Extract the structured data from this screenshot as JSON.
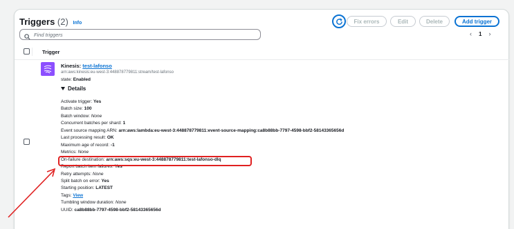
{
  "header": {
    "title": "Triggers",
    "count": "(2)",
    "info": "Info",
    "buttons": {
      "fix_errors": "Fix errors",
      "edit": "Edit",
      "delete": "Delete",
      "add_trigger": "Add trigger"
    }
  },
  "search": {
    "placeholder": "Find triggers"
  },
  "pagination": {
    "current_page": "1"
  },
  "table": {
    "column_trigger": "Trigger"
  },
  "trigger": {
    "service": "Kinesis:",
    "name": "test-lafonso",
    "arn": "arn:aws:kinesis:eu-west-3:448878779811:stream/test-lafonso",
    "state_label": "state:",
    "state_value": "Enabled",
    "details_label": "Details",
    "details": [
      {
        "label": "Activate trigger:",
        "value": "Yes",
        "style": "bold"
      },
      {
        "label": "Batch size:",
        "value": "100",
        "style": "bold"
      },
      {
        "label": "Batch window:",
        "value": "None",
        "style": "italic"
      },
      {
        "label": "Concurrent batches per shard:",
        "value": "1",
        "style": "bold"
      },
      {
        "label": "Event source mapping ARN:",
        "value": "arn:aws:lambda:eu-west-3:448878779811:event-source-mapping:ca8b88bb-7797-4598-bbf2-58143365656d",
        "style": "bold"
      },
      {
        "label": "Last processing result:",
        "value": "OK",
        "style": "bold"
      },
      {
        "label": "Maximum age of record:",
        "value": "-1",
        "style": "bold"
      },
      {
        "label": "Metrics:",
        "value": "None",
        "style": "italic"
      },
      {
        "label": "On-failure destination:",
        "value": "arn:aws:sqs:eu-west-3:448878779811:test-lafonso-dlq",
        "style": "bold"
      },
      {
        "label": "Report batch item failures:",
        "value": "Yes",
        "style": "bold"
      },
      {
        "label": "Retry attempts:",
        "value": "None",
        "style": "italic"
      },
      {
        "label": "Split batch on error:",
        "value": "Yes",
        "style": "bold"
      },
      {
        "label": "Starting position:",
        "value": "LATEST",
        "style": "bold"
      },
      {
        "label": "Tags:",
        "value": "View",
        "style": "link"
      },
      {
        "label": "Tumbling window duration:",
        "value": "None",
        "style": "italic"
      },
      {
        "label": "UUID:",
        "value": "ca8b88bb-7797-4598-bbf2-58143365656d",
        "style": "bold"
      }
    ]
  },
  "annotation": {
    "color": "#e02020"
  },
  "colors": {
    "accent": "#0972d3",
    "kinesis": "#8c4fff"
  }
}
